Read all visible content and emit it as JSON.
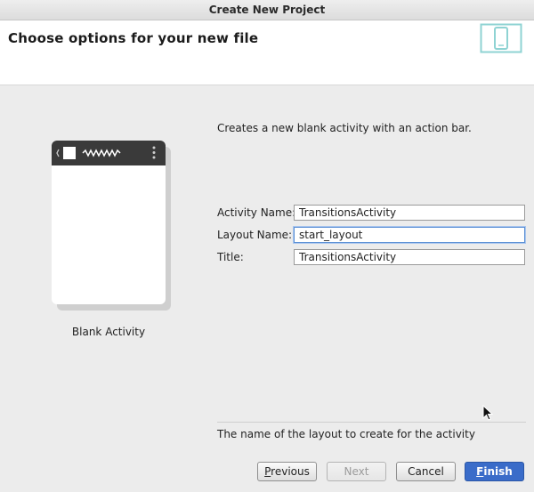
{
  "window": {
    "title": "Create New Project"
  },
  "header": {
    "title": "Choose options for your new file",
    "icon": "device-layout-icon"
  },
  "template": {
    "name": "Blank Activity",
    "preview_icon": "phone-preview-icon"
  },
  "description": "Creates a new blank activity with an action bar.",
  "form": {
    "activity_name": {
      "label": "Activity Name:",
      "value": "TransitionsActivity"
    },
    "layout_name": {
      "label": "Layout Name:",
      "value": "start_layout"
    },
    "title": {
      "label": "Title:",
      "value": "TransitionsActivity"
    }
  },
  "help_text": "The name of the layout to create for the activity",
  "buttons": {
    "previous": {
      "mnemonic": "P",
      "rest": "revious"
    },
    "next": {
      "label": "Next"
    },
    "cancel": {
      "label": "Cancel"
    },
    "finish": {
      "mnemonic": "F",
      "rest": "inish"
    }
  },
  "colors": {
    "accent": "#3a6cc9",
    "focus_ring": "#5b8fd4",
    "header_icon": "#8fd3d3"
  }
}
